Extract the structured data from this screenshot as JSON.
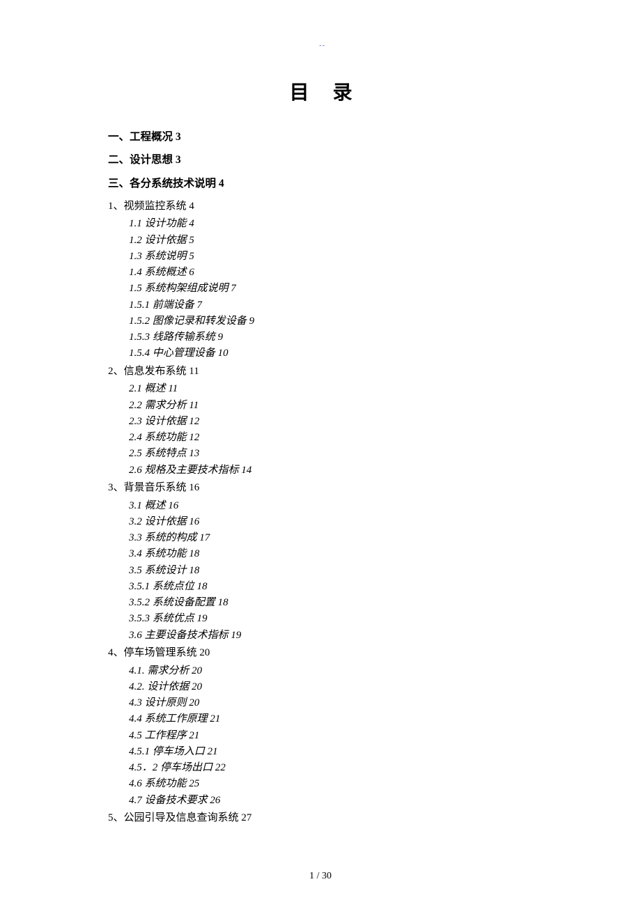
{
  "header_mark": "--",
  "title": "目录",
  "sections": [
    {
      "level": "h1",
      "text": "一、工程概况 3"
    },
    {
      "level": "h1",
      "text": "二、设计思想 3"
    },
    {
      "level": "h1",
      "text": "三、各分系统技术说明 4"
    },
    {
      "level": "h2",
      "text": "1、视频监控系统 4"
    },
    {
      "level": "h3",
      "text": "1.1 设计功能 4"
    },
    {
      "level": "h3",
      "text": "1.2 设计依据 5"
    },
    {
      "level": "h3",
      "text": "1.3  系统说明 5"
    },
    {
      "level": "h3",
      "text": "1.4 系统概述 6"
    },
    {
      "level": "h3",
      "text": "1.5 系统构架组成说明 7"
    },
    {
      "level": "h3",
      "text": "1.5.1   前端设备 7"
    },
    {
      "level": "h3",
      "text": "1.5.2 图像记录和转发设备 9"
    },
    {
      "level": "h3",
      "text": "1.5.3 线路传输系统 9"
    },
    {
      "level": "h3",
      "text": "1.5.4   中心管理设备 10"
    },
    {
      "level": "h2",
      "text": "2、信息发布系统 11"
    },
    {
      "level": "h3",
      "text": "2.1  概述 11"
    },
    {
      "level": "h3",
      "text": "2.2  需求分析 11"
    },
    {
      "level": "h3",
      "text": "2.3 设计依据 12"
    },
    {
      "level": "h3",
      "text": "2.4 系统功能 12"
    },
    {
      "level": "h3",
      "text": "2.5 系统特点 13"
    },
    {
      "level": "h3",
      "text": "2.6  规格及主要技术指标 14"
    },
    {
      "level": "h2",
      "text": "3、背景音乐系统 16"
    },
    {
      "level": "h3",
      "text": "3.1  概述 16"
    },
    {
      "level": "h3",
      "text": "3.2 设计依据 16"
    },
    {
      "level": "h3",
      "text": "3.3  系统的构成 17"
    },
    {
      "level": "h3",
      "text": "3.4  系统功能 18"
    },
    {
      "level": "h3",
      "text": "3.5  系统设计 18"
    },
    {
      "level": "h3",
      "text": "3.5.1 系统点位 18"
    },
    {
      "level": "h3",
      "text": "3.5.2 系统设备配置 18"
    },
    {
      "level": "h3",
      "text": "3.5.3 系统优点 19"
    },
    {
      "level": "h3",
      "text": "3.6  主要设备技术指标 19"
    },
    {
      "level": "h2",
      "text": "4、停车场管理系统 20"
    },
    {
      "level": "h3",
      "text": "4.1. 需求分析 20"
    },
    {
      "level": "h3",
      "text": "4.2. 设计依据 20"
    },
    {
      "level": "h3",
      "text": "4.3 设计原则 20"
    },
    {
      "level": "h3",
      "text": "4.4 系统工作原理 21"
    },
    {
      "level": "h3",
      "text": "4.5  工作程序 21"
    },
    {
      "level": "h3",
      "text": "4.5.1 停车场入口 21"
    },
    {
      "level": "h3",
      "text": "4.5．2 停车场出口 22"
    },
    {
      "level": "h3",
      "text": "4.6 系统功能 25"
    },
    {
      "level": "h3",
      "text": "4.7 设备技术要求 26"
    },
    {
      "level": "h2",
      "text": "5、公园引导及信息查询系统 27"
    }
  ],
  "footer": "1  / 30"
}
